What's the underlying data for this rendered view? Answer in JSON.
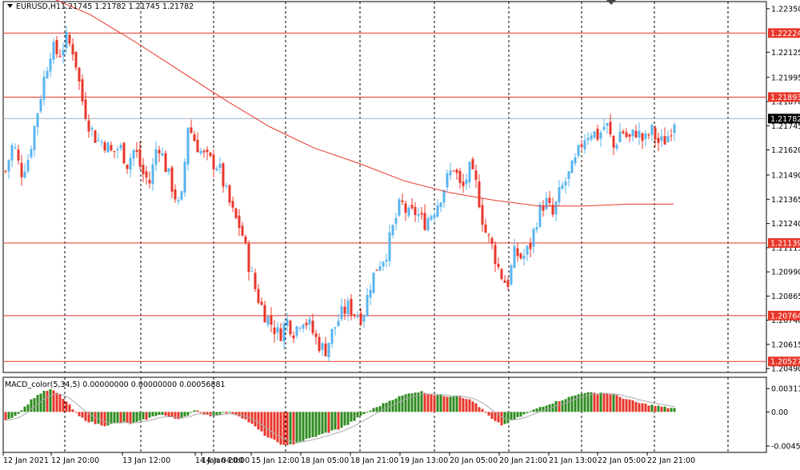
{
  "header": {
    "symbol_label": "EURUSD,H1",
    "ohlc_text": "1.21745 1.21782 1.21745 1.21782",
    "macd_label": "MACD_color(5,34,5) 0.00000000 0.00000000 0.00056881"
  },
  "colors": {
    "bull": "#5ab4ee",
    "bear": "#e8362a",
    "ma": "#e8362a",
    "level_line": "#e8362a",
    "price_line": "#9bb3c4",
    "grid": "#000000",
    "macd_up": "#2e8b1f",
    "macd_down": "#e8362a",
    "signal": "#a8a8a8"
  },
  "chart_data": {
    "type": "candlestick",
    "symbol": "EURUSD",
    "timeframe": "H1",
    "price_axis_ticks": [
      "1.22350",
      "1.22125",
      "1.21995",
      "1.21870",
      "1.21745",
      "1.21620",
      "1.21490",
      "1.21365",
      "1.21240",
      "1.21115",
      "1.20990",
      "1.20865",
      "1.20740",
      "1.20615",
      "1.20490"
    ],
    "price_axis_tick_values": [
      1.2235,
      1.22125,
      1.21995,
      1.2187,
      1.21745,
      1.2162,
      1.2149,
      1.21365,
      1.2124,
      1.21115,
      1.2099,
      1.20865,
      1.2074,
      1.20615,
      1.2049
    ],
    "y_range": [
      1.2047,
      1.2237
    ],
    "horizontal_levels": [
      {
        "label": "1.22224",
        "value": 1.22224
      },
      {
        "label": "1.21893",
        "value": 1.21893
      },
      {
        "label": "1.21139",
        "value": 1.21139
      },
      {
        "label": "1.20764",
        "value": 1.20764
      },
      {
        "label": "1.20527",
        "value": 1.20527
      }
    ],
    "current_price": {
      "label": "1.21782",
      "value": 1.21782
    },
    "time_axis_labels": [
      "12 Jan 2021",
      "12 Jan 20:00",
      "13 Jan 12:00",
      "14 Jan 04:00",
      "14 Jan 20:00",
      "15 Jan 12:00",
      "18 Jan 05:00",
      "18 Jan 21:00",
      "19 Jan 13:00",
      "20 Jan 05:00",
      "20 Jan 21:00",
      "21 Jan 13:00",
      "22 Jan 05:00",
      "22 Jan 21:00"
    ],
    "close_path": [
      1.2151,
      1.2166,
      1.215,
      1.2158,
      1.2178,
      1.2198,
      1.2215,
      1.2211,
      1.2219,
      1.2213,
      1.2189,
      1.2175,
      1.2167,
      1.2166,
      1.216,
      1.2164,
      1.2155,
      1.2163,
      1.215,
      1.2145,
      1.2167,
      1.2154,
      1.2142,
      1.213,
      1.2175,
      1.2166,
      1.2159,
      1.2156,
      1.2154,
      1.214,
      1.2128,
      1.2121,
      1.2103,
      1.2088,
      1.2078,
      1.2072,
      1.2066,
      1.2074,
      1.2068,
      1.2076,
      1.2071,
      1.2063,
      1.2058,
      1.2068,
      1.2076,
      1.2081,
      1.2078,
      1.2076,
      1.2093,
      1.2103,
      1.2108,
      1.2122,
      1.2135,
      1.2128,
      1.213,
      1.2124,
      1.2129,
      1.2136,
      1.2146,
      1.2154,
      1.214,
      1.2152,
      1.2143,
      1.2121,
      1.2112,
      1.2099,
      1.2092,
      1.2109,
      1.2106,
      1.2112,
      1.2128,
      1.2136,
      1.2128,
      1.2141,
      1.2148,
      1.2156,
      1.2168,
      1.2172,
      1.2169,
      1.2176,
      1.2163,
      1.2173,
      1.2167,
      1.2172,
      1.2166,
      1.2172,
      1.2165,
      1.2168,
      1.2178
    ],
    "ma_path": [
      1.2249,
      1.2242,
      1.2232,
      1.2218,
      1.2203,
      1.2188,
      1.2174,
      1.2163,
      1.2155,
      1.2146,
      1.214,
      1.2136,
      1.2133,
      1.2133,
      1.2134,
      1.2134
    ],
    "macd": {
      "label": "MACD_color(5,34,5)",
      "ticks": [
        "0.003119",
        "0.00",
        "-0.004553"
      ],
      "tick_values": [
        0.003119,
        0.0,
        -0.004553
      ],
      "y_range": [
        -0.0052,
        0.0042
      ],
      "histogram": [
        -0.001,
        -0.0006,
        0.0005,
        0.0018,
        0.0026,
        0.003,
        0.0023,
        0.001,
        -0.0005,
        -0.0012,
        -0.0016,
        -0.0018,
        -0.0016,
        -0.0014,
        -0.0016,
        -0.0012,
        -0.0008,
        -0.0003,
        -0.0006,
        -0.001,
        -0.0005,
        0.0002,
        -0.0003,
        -0.0006,
        -0.0001,
        -0.0002,
        -0.0006,
        -0.0014,
        -0.0024,
        -0.0034,
        -0.004,
        -0.0046,
        -0.0042,
        -0.0038,
        -0.0034,
        -0.003,
        -0.0026,
        -0.0022,
        -0.0016,
        -0.0008,
        0.0,
        0.0006,
        0.0012,
        0.0018,
        0.0022,
        0.0026,
        0.0027,
        0.0024,
        0.0022,
        0.0021,
        0.0022,
        0.0018,
        0.0012,
        0.0,
        -0.0012,
        -0.0018,
        -0.0012,
        -0.0006,
        0.0,
        0.0006,
        0.001,
        0.0014,
        0.0018,
        0.0022,
        0.0026,
        0.0025,
        0.0026,
        0.0024,
        0.002,
        0.0016,
        0.0012,
        0.001,
        0.0008,
        0.0006,
        0.0005
      ]
    }
  }
}
